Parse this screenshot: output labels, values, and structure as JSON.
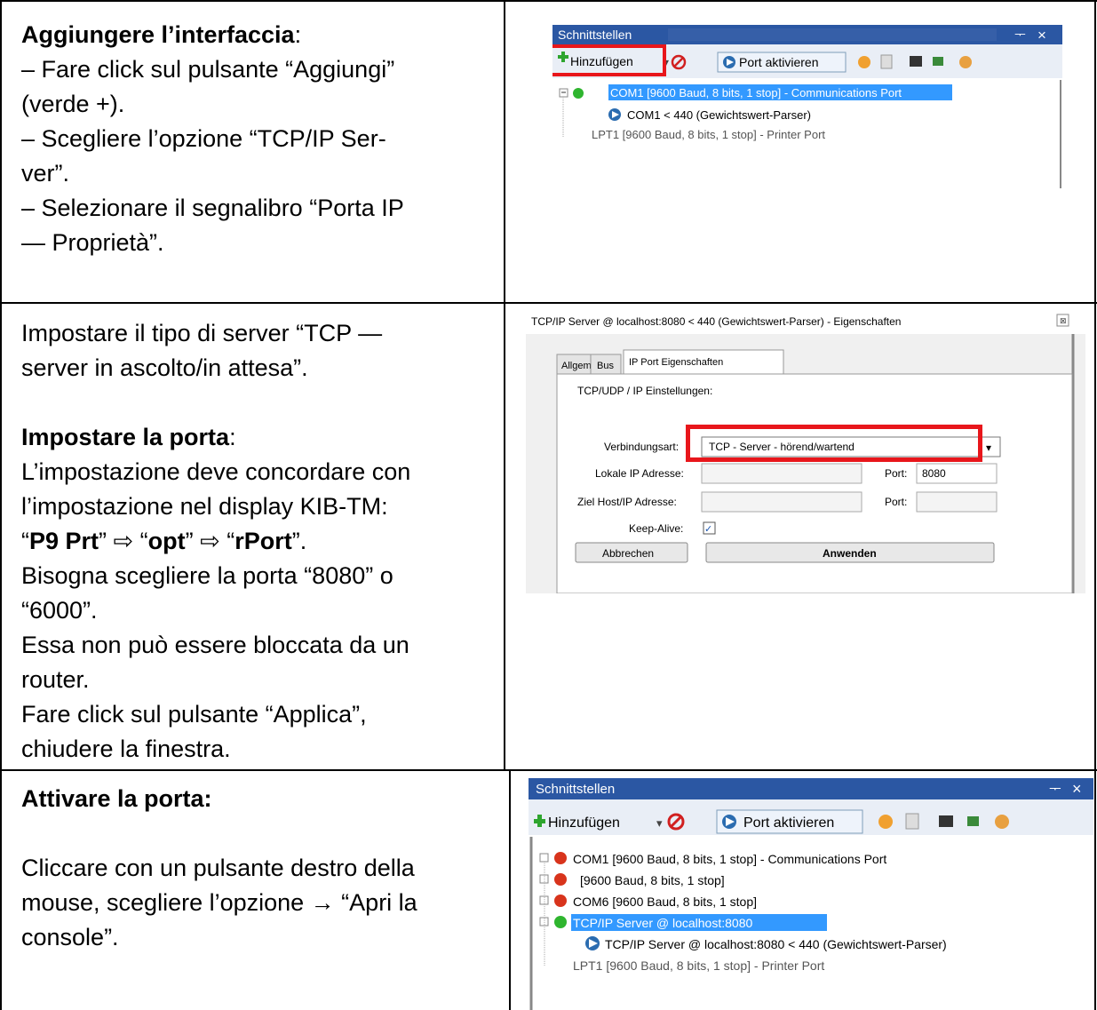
{
  "row1": {
    "heading": "Aggiungere l’interfaccia",
    "heading_suffix": ":",
    "lines": [
      "– Fare click sul pulsante “Aggiungi”",
      "(verde +).",
      "– Scegliere l’opzione “TCP/IP Ser-",
      "ver”.",
      "– Selezionare il segnalibro “Porta IP",
      "— Proprietà”."
    ]
  },
  "row2": {
    "intro": [
      "Impostare il tipo di server “TCP —",
      "server in ascolto/in attesa”."
    ],
    "heading": "Impostare la porta",
    "heading_suffix": ":",
    "line_a": "L’impostazione deve concordare con",
    "line_b": "l’impostazione nel display KIB-TM:",
    "path": {
      "q1": "“",
      "p1": "P9 Prt",
      "q2": "” ⇨ “",
      "p2": "opt",
      "q3": "” ⇨ “",
      "p3": "rPort",
      "q4": "”."
    },
    "rest": [
      "Bisogna scegliere la porta “8080” o",
      "“6000”.",
      "Essa non può essere bloccata da un",
      "router.",
      "Fare click sul pulsante “Applica”,",
      "chiudere la finestra."
    ]
  },
  "row3": {
    "heading": "Attivare la porta:",
    "lines": [
      "Cliccare con un pulsante destro della",
      "mouse, scegliere l’opzione → “Apri la",
      "console”."
    ]
  },
  "shot1": {
    "title": "Schnittstellen",
    "pin": "ᅮ",
    "close": "×",
    "add": "Hinzufügen",
    "activate": "Port aktivieren",
    "tree": [
      "COM1 [9600 Baud, 8 bits, 1 stop] - Communications Port",
      "COM1 < 440 (Gewichtswert-Parser)",
      "LPT1 [9600 Baud, 8 bits, 1 stop] - Printer Port"
    ]
  },
  "shot2": {
    "title": "TCP/IP Server @ localhost:8080 < 440 (Gewichtswert-Parser) - Eigenschaften",
    "tabs": [
      "Allgemein",
      "Bus",
      "IP Port Eigenschaften"
    ],
    "group": "TCP/UDP / IP Einstellungen:",
    "conn_label": "Verbindungsart:",
    "conn_value": "TCP - Server - hörend/wartend",
    "local_label": "Lokale IP Adresse:",
    "port_label": "Port:",
    "port_value": "8080",
    "target_label": "Ziel Host/IP Adresse:",
    "port2_label": "Port:",
    "keepalive_label": "Keep-Alive:",
    "cancel": "Abbrechen",
    "apply": "Anwenden"
  },
  "shot3": {
    "title": "Schnittstellen",
    "pin": "ᅮ",
    "close": "×",
    "add": "Hinzufügen",
    "activate": "Port aktivieren",
    "tree": [
      "COM1 [9600 Baud, 8 bits, 1 stop] - Communications Port",
      "[9600 Baud, 8 bits, 1 stop]",
      "COM6 [9600 Baud, 8 bits, 1 stop]",
      "TCP/IP Server @ localhost:8080",
      "TCP/IP Server @ localhost:8080 < 440 (Gewichtswert-Parser)",
      "LPT1 [9600 Baud, 8 bits, 1 stop] - Printer Port"
    ]
  },
  "colors": {
    "highlight_red": "#e8161b",
    "title_blue": "#2b57a3",
    "selection": "#3399ff"
  }
}
